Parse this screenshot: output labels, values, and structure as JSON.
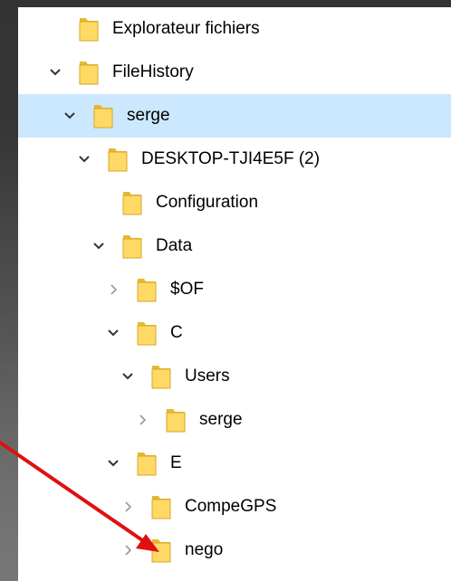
{
  "tree": {
    "items": [
      {
        "label": "Explorateur fichiers",
        "level": 0,
        "expand": "none",
        "selected": false,
        "icon": "folder-icon"
      },
      {
        "label": "FileHistory",
        "level": 0,
        "expand": "expanded",
        "selected": false,
        "icon": "folder-icon"
      },
      {
        "label": "serge",
        "level": 0,
        "expand": "expanded",
        "selected": true,
        "icon": "folder-icon"
      },
      {
        "label": "DESKTOP-TJI4E5F (2)",
        "level": 1,
        "expand": "expanded",
        "selected": false,
        "icon": "folder-icon"
      },
      {
        "label": "Configuration",
        "level": 2,
        "expand": "none",
        "selected": false,
        "icon": "folder-icon"
      },
      {
        "label": "Data",
        "level": 2,
        "expand": "expanded",
        "selected": false,
        "icon": "folder-icon"
      },
      {
        "label": "$OF",
        "level": 3,
        "expand": "collapsed",
        "selected": false,
        "icon": "folder-icon"
      },
      {
        "label": "C",
        "level": 3,
        "expand": "expanded",
        "selected": false,
        "icon": "folder-icon"
      },
      {
        "label": "Users",
        "level": 4,
        "expand": "expanded",
        "selected": false,
        "icon": "folder-icon"
      },
      {
        "label": "serge",
        "level": 5,
        "expand": "collapsed",
        "selected": false,
        "icon": "folder-icon"
      },
      {
        "label": "E",
        "level": 3,
        "expand": "expanded",
        "selected": false,
        "icon": "folder-icon"
      },
      {
        "label": "CompeGPS",
        "level": 4,
        "expand": "collapsed",
        "selected": false,
        "icon": "folder-icon"
      },
      {
        "label": "nego",
        "level": 4,
        "expand": "collapsed",
        "selected": false,
        "icon": "folder-icon"
      }
    ]
  },
  "colors": {
    "selected_row": "#cce8ff",
    "folder_fill": "#ffd966",
    "folder_back": "#e8b92c",
    "arrow": "#e01010",
    "chevron": "#333333"
  },
  "annotation": {
    "icon": "red-arrow-icon",
    "target": "nego"
  }
}
